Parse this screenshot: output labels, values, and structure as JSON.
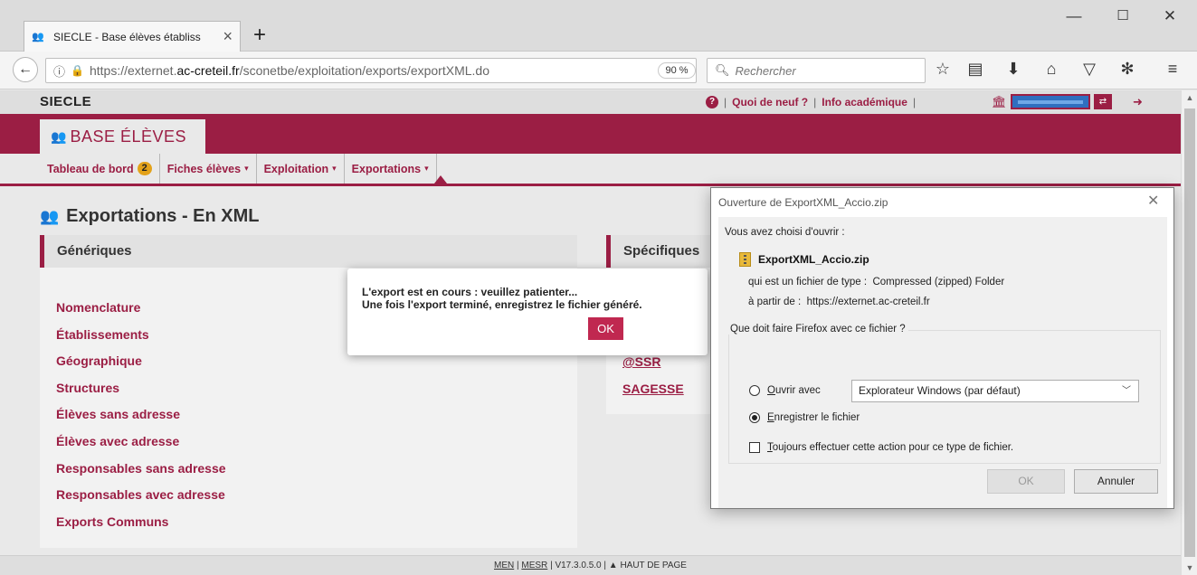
{
  "browser": {
    "tab_title": "SIECLE - Base élèves établiss",
    "url_host": "https://externet.",
    "url_domain": "ac-creteil.fr",
    "url_path": "/sconetbe/exploitation/exports/exportXML.do",
    "zoom": "90 %",
    "search_placeholder": "Rechercher"
  },
  "site": {
    "name": "SIECLE",
    "links": {
      "news": "Quoi de neuf ?",
      "academic": "Info académique",
      "sep": "|"
    }
  },
  "bandeau": {
    "title": "BASE ÉLÈVES"
  },
  "menu": {
    "items": [
      {
        "label": "Tableau de bord",
        "badge": "2"
      },
      {
        "label": "Fiches élèves",
        "caret": "▾"
      },
      {
        "label": "Exploitation",
        "caret": "▾"
      },
      {
        "label": "Exportations",
        "caret": "▾"
      }
    ]
  },
  "page": {
    "title": "Exportations - En XML",
    "generic": {
      "heading": "Génériques",
      "links": [
        "Nomenclature",
        "Établissements",
        "Géographique",
        "Structures",
        "Élèves sans adresse",
        "Élèves avec adresse",
        "Responsables sans adresse",
        "Responsables avec adresse",
        "Exports Communs"
      ]
    },
    "specific": {
      "heading": "Spécifiques",
      "links": [
        "@SSR",
        "SAGESSE"
      ]
    },
    "footer": {
      "men": "MEN",
      "mesr": "MESR",
      "version": "| V17.3.0.5.0 |",
      "top": "▲ HAUT DE PAGE"
    }
  },
  "alert": {
    "line1": "L'export est en cours : veuillez patienter...",
    "line2": "Une fois l'export terminé, enregistrez le fichier généré.",
    "ok": "OK"
  },
  "dialog": {
    "title": "Ouverture de ExportXML_Accio.zip",
    "chosen": "Vous avez choisi d'ouvrir :",
    "filename": "ExportXML_Accio.zip",
    "type_label": "qui est un fichier de type :",
    "type_value": "Compressed (zipped) Folder",
    "from_label": "à partir de :",
    "from_value": "https://externet.ac-creteil.fr",
    "question": "Que doit faire Firefox avec ce fichier ?",
    "open_with_u": "O",
    "open_with_rest": "uvrir avec",
    "open_with_app": "Explorateur Windows (par défaut)",
    "save_u": "E",
    "save_rest": "nregistrer le fichier",
    "always_u": "T",
    "always_rest": "oujours effectuer cette action pour ce type de fichier.",
    "ok": "OK",
    "cancel": "Annuler",
    "selected_option": "save"
  },
  "colors": {
    "brand": "#9b1e44",
    "badge": "#e3a21a",
    "ok_button": "#c02850"
  }
}
